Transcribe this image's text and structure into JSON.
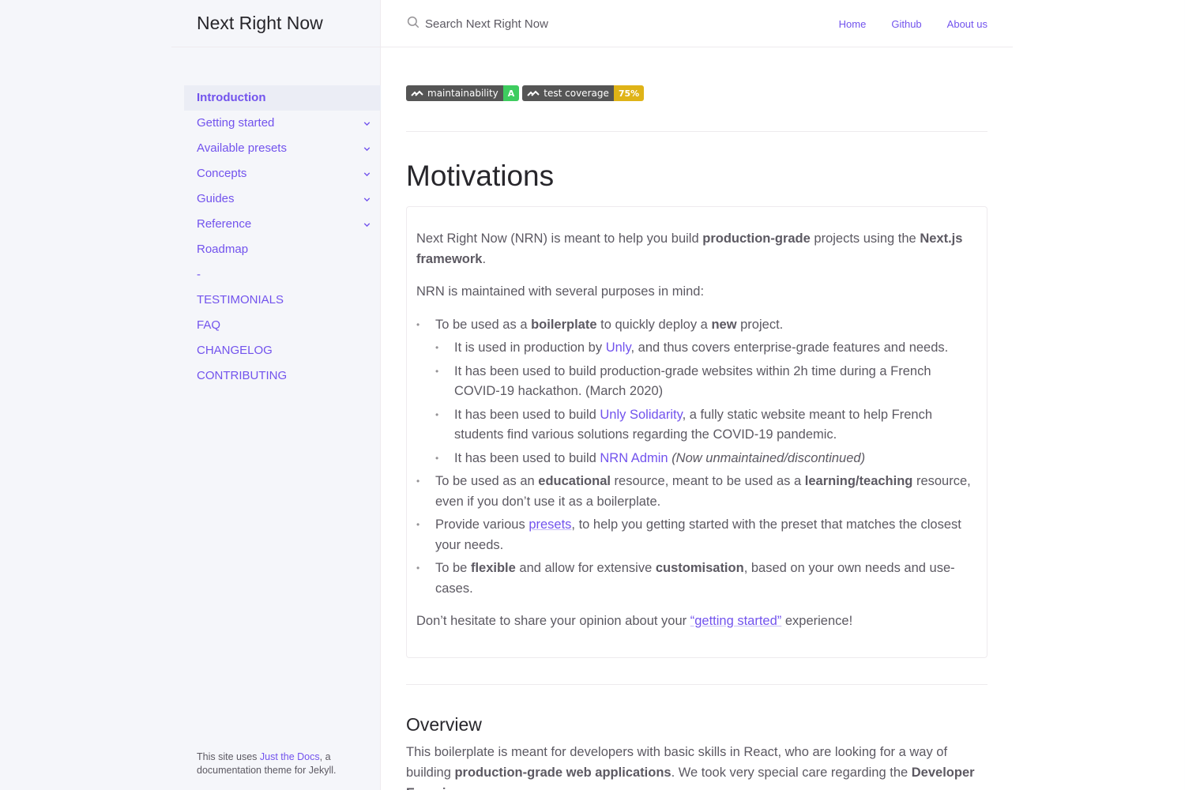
{
  "site": {
    "title": "Next Right Now"
  },
  "search": {
    "placeholder": "Search Next Right Now"
  },
  "aux_nav": [
    "Home",
    "Github",
    "About us"
  ],
  "sidebar": {
    "items": [
      {
        "label": "Introduction",
        "active": true,
        "expandable": false
      },
      {
        "label": "Getting started",
        "expandable": true
      },
      {
        "label": "Available presets",
        "expandable": true
      },
      {
        "label": "Concepts",
        "expandable": true
      },
      {
        "label": "Guides",
        "expandable": true
      },
      {
        "label": "Reference",
        "expandable": true
      },
      {
        "label": "Roadmap",
        "expandable": false
      },
      {
        "label": "-",
        "expandable": false
      },
      {
        "label": "TESTIMONIALS",
        "expandable": false
      },
      {
        "label": "FAQ",
        "expandable": false
      },
      {
        "label": "CHANGELOG",
        "expandable": false
      },
      {
        "label": "CONTRIBUTING",
        "expandable": false
      }
    ],
    "footer": {
      "prefix": "This site uses ",
      "link": "Just the Docs",
      "suffix": ", a documentation theme for Jekyll."
    }
  },
  "badges": [
    {
      "label": "maintainability",
      "value": "A",
      "color": "#3ecc5f"
    },
    {
      "label": "test coverage",
      "value": "75%",
      "color": "#dfb317"
    }
  ],
  "motivations": {
    "heading": "Motivations",
    "intro": {
      "t1": "Next Right Now (NRN) is meant to help you build ",
      "b1": "production-grade",
      "t2": " projects using the ",
      "b2": "Next.js framework",
      "t3": "."
    },
    "purposes_intro": "NRN is maintained with several purposes in mind:",
    "item1": {
      "t1": "To be used as a ",
      "b1": "boilerplate",
      "t2": " to quickly deploy a ",
      "b2": "new",
      "t3": " project."
    },
    "sub1": {
      "t1": "It is used in production by ",
      "link": "Unly",
      "t2": ", and thus covers enterprise-grade features and needs."
    },
    "sub2": {
      "text": "It has been used to build production-grade websites within 2h time during a French COVID-19 hackathon. (March 2020)"
    },
    "sub3": {
      "t1": "It has been used to build ",
      "link": "Unly Solidarity",
      "t2": ", a fully static website meant to help French students find various solutions regarding the COVID-19 pandemic."
    },
    "sub4": {
      "t1": "It has been used to build ",
      "link": "NRN Admin",
      "t2": " ",
      "i": "(Now unmaintained/discontinued)"
    },
    "item2": {
      "t1": "To be used as an ",
      "b1": "educational",
      "t2": " resource, meant to be used as a ",
      "b2": "learning/teaching",
      "t3": " resource, even if you don’t use it as a boilerplate."
    },
    "item3": {
      "t1": "Provide various ",
      "link": "presets",
      "t2": ", to help you getting started with the preset that matches the closest your needs."
    },
    "item4": {
      "t1": "To be ",
      "b1": "flexible",
      "t2": " and allow for extensive ",
      "b2": "customisation",
      "t3": ", based on your own needs and use-cases."
    },
    "outro": {
      "t1": "Don’t hesitate to share your opinion about your ",
      "link": "“getting started”",
      "t2": " experience!"
    }
  },
  "overview": {
    "heading": "Overview",
    "t1": "This boilerplate is meant for developers with basic skills in React, who are looking for a way of building ",
    "b1": "production-grade web applications",
    "t2": ". We took very special care regarding the ",
    "b2": "Developer Experience"
  }
}
